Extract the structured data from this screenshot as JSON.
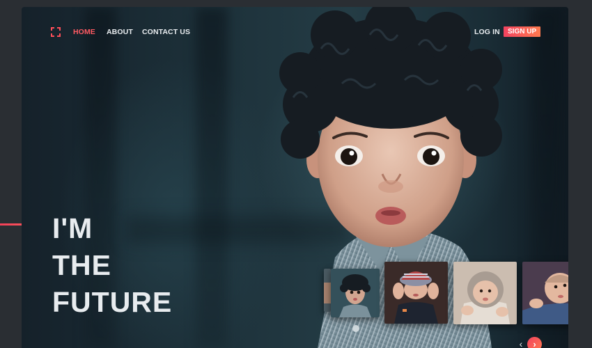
{
  "nav": {
    "items": [
      {
        "label": "HOME",
        "active": true
      },
      {
        "label": "ABOUT",
        "active": false
      },
      {
        "label": "CONTACT US",
        "active": false
      }
    ],
    "login_label": "LOG IN",
    "signup_label": "SIGN UP"
  },
  "hero": {
    "headline_lines": [
      "I'M",
      "THE",
      "FUTURE"
    ]
  },
  "carousel": {
    "thumbnails": [
      {
        "name": "thumb-partial"
      },
      {
        "name": "thumb-curly-child"
      },
      {
        "name": "thumb-child-striped-hat"
      },
      {
        "name": "thumb-baby-hood"
      },
      {
        "name": "thumb-baby-blanket"
      }
    ],
    "prev_icon": "chevron-left-icon",
    "next_icon": "chevron-right-icon"
  },
  "colors": {
    "accent": "#ff4f5a",
    "accent_gradient_end": "#ff7a4f",
    "background": "#2a2e33",
    "text": "#e8ecef"
  }
}
